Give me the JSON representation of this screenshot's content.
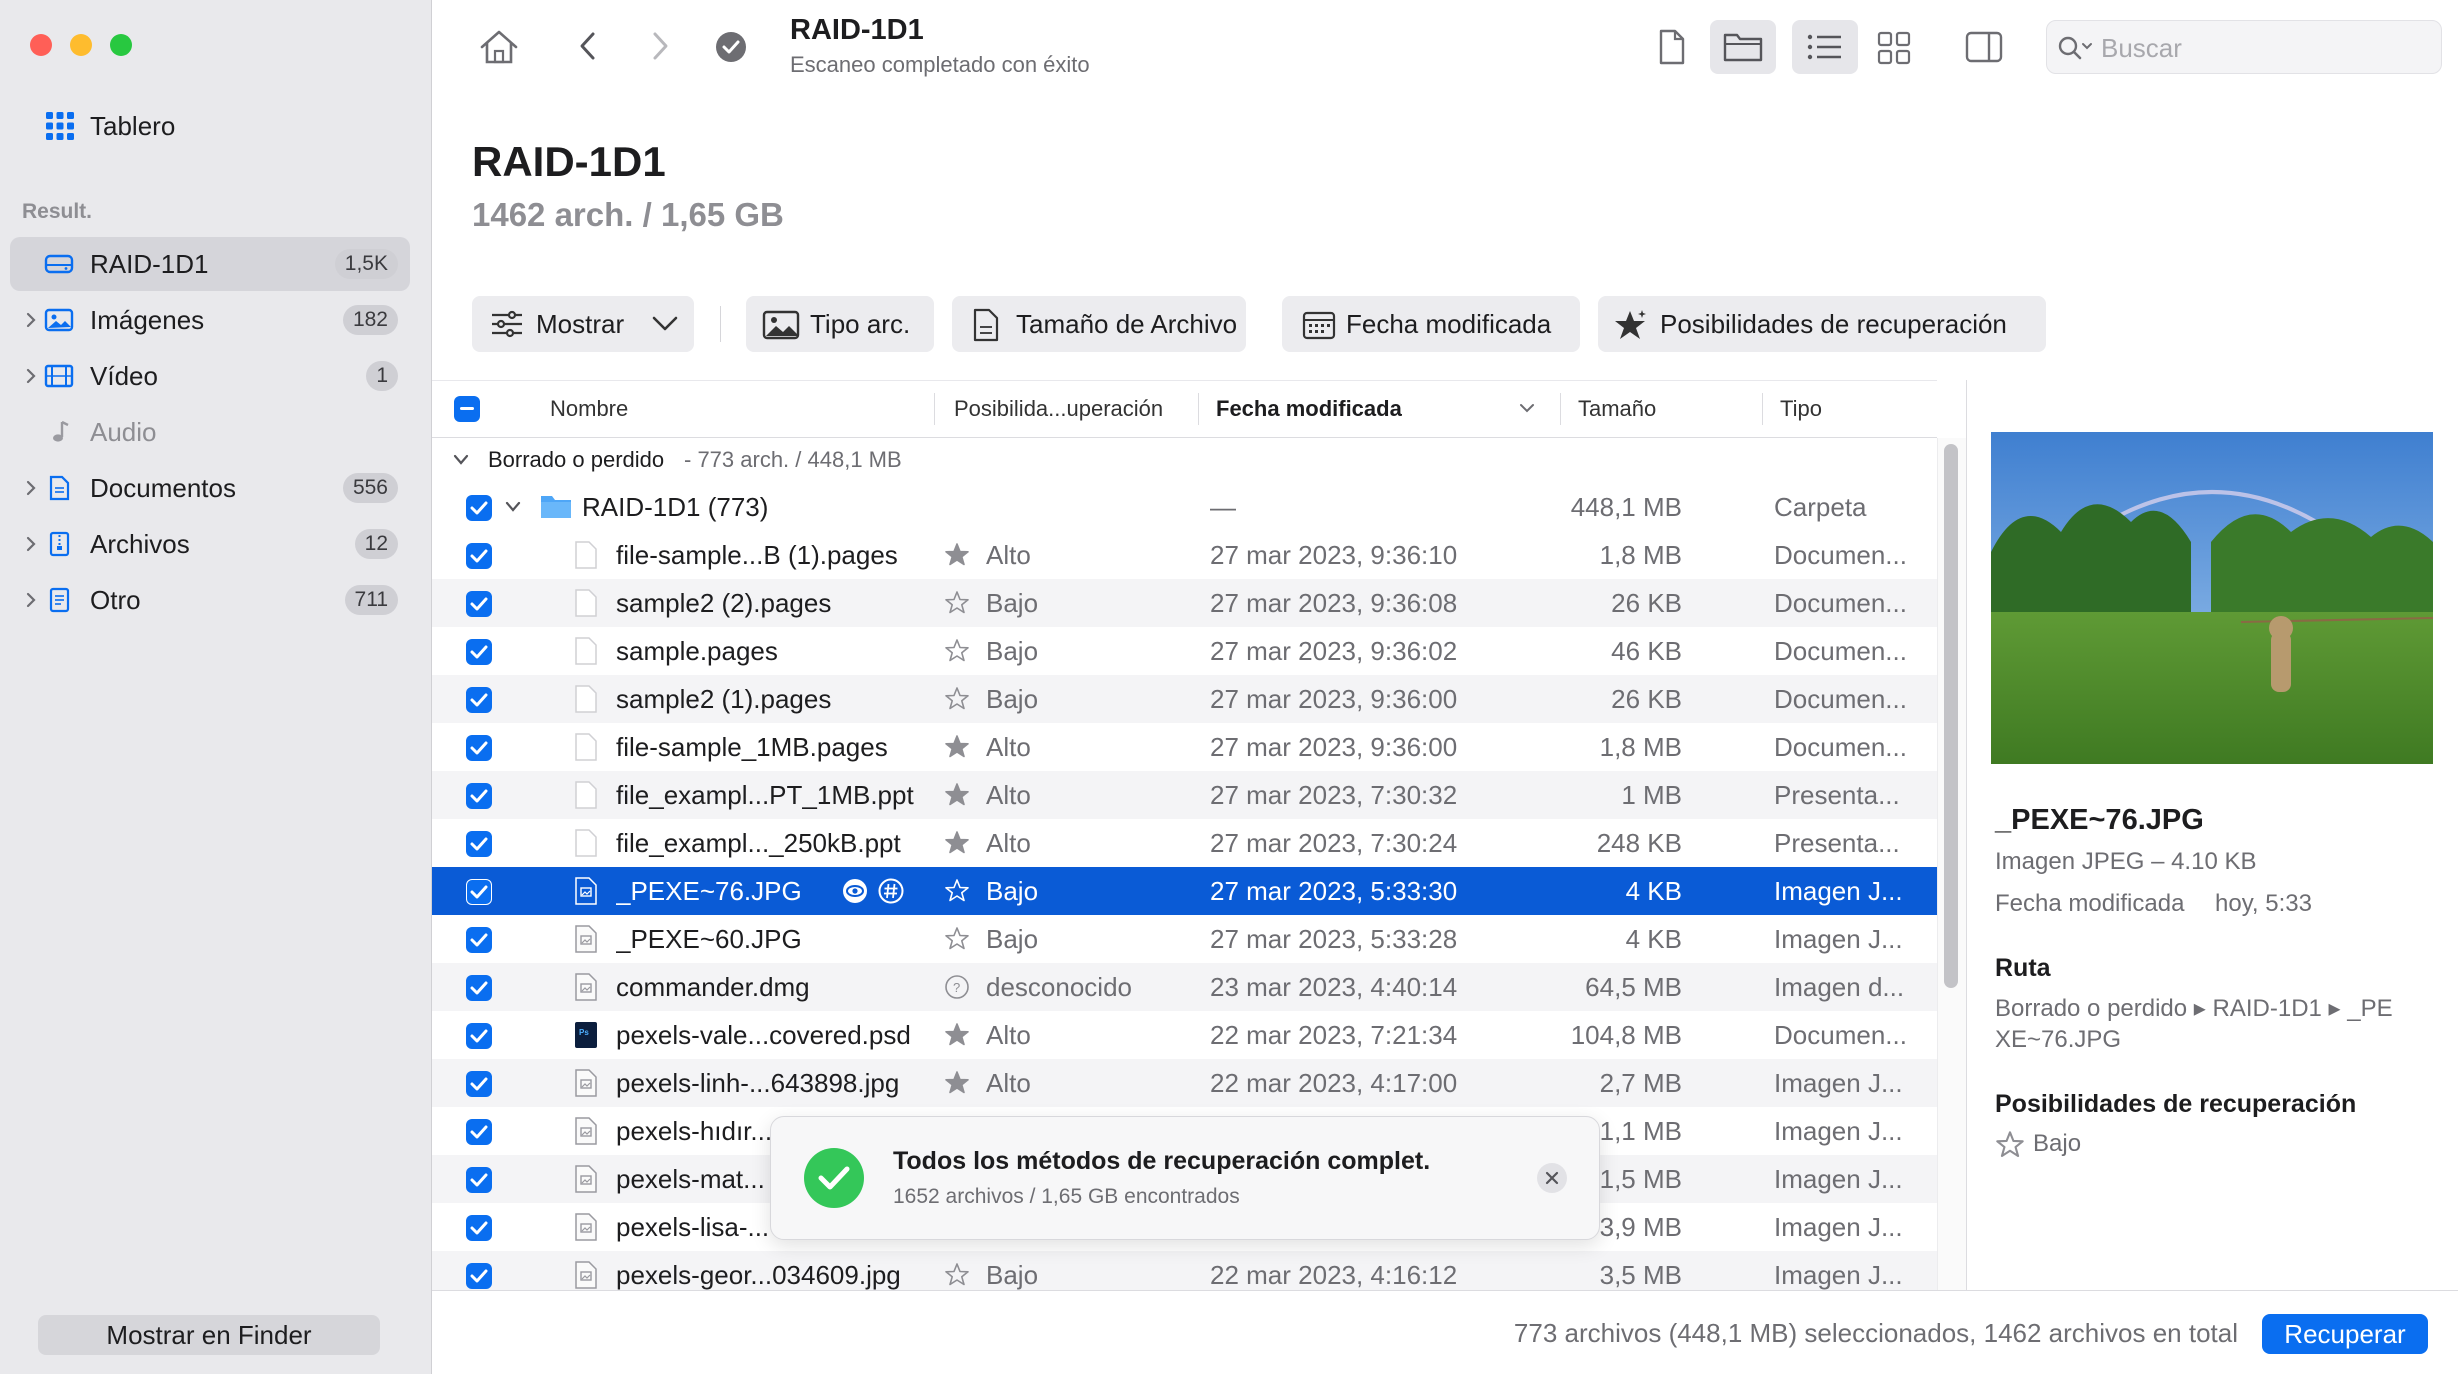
{
  "sidebar": {
    "dashboard_label": "Tablero",
    "results_header": "Result.",
    "items": [
      {
        "label": "RAID-1D1",
        "count": "1,5K",
        "icon": "drive-icon"
      },
      {
        "label": "Imágenes",
        "count": "182",
        "icon": "image-icon"
      },
      {
        "label": "Vídeo",
        "count": "1",
        "icon": "film-icon"
      },
      {
        "label": "Audio",
        "count": "",
        "icon": "music-note-icon"
      },
      {
        "label": "Documentos",
        "count": "556",
        "icon": "document-icon"
      },
      {
        "label": "Archivos",
        "count": "12",
        "icon": "archive-icon"
      },
      {
        "label": "Otro",
        "count": "711",
        "icon": "other-file-icon"
      }
    ],
    "finder_button": "Mostrar en Finder"
  },
  "toolbar": {
    "title": "RAID-1D1",
    "subtitle": "Escaneo completado con éxito",
    "search_placeholder": "Buscar"
  },
  "header": {
    "title": "RAID-1D1",
    "summary": "1462 arch. / 1,65 GB"
  },
  "filters": {
    "show": "Mostrar",
    "file_type": "Tipo arc.",
    "file_size": "Tamaño de Archivo",
    "date_modified": "Fecha modificada",
    "recovery_chances": "Posibilidades de recuperación"
  },
  "table": {
    "columns": {
      "name": "Nombre",
      "chance": "Posibilida...uperación",
      "date": "Fecha modificada",
      "size": "Tamaño",
      "type": "Tipo"
    },
    "group": {
      "label": "Borrado o perdido",
      "summary": " - 773 arch. / 448,1 MB"
    },
    "folder": {
      "name": "RAID-1D1 (773)",
      "date": "—",
      "size": "448,1 MB",
      "type": "Carpeta"
    },
    "rows": [
      {
        "name": "file-sample...B (1).pages",
        "chance": "Alto",
        "date": "27 mar 2023, 9:36:10",
        "size": "1,8 MB",
        "type": "Documen..."
      },
      {
        "name": "sample2 (2).pages",
        "chance": "Bajo",
        "date": "27 mar 2023, 9:36:08",
        "size": "26 KB",
        "type": "Documen..."
      },
      {
        "name": "sample.pages",
        "chance": "Bajo",
        "date": "27 mar 2023, 9:36:02",
        "size": "46 KB",
        "type": "Documen..."
      },
      {
        "name": "sample2 (1).pages",
        "chance": "Bajo",
        "date": "27 mar 2023, 9:36:00",
        "size": "26 KB",
        "type": "Documen..."
      },
      {
        "name": "file-sample_1MB.pages",
        "chance": "Alto",
        "date": "27 mar 2023, 9:36:00",
        "size": "1,8 MB",
        "type": "Documen..."
      },
      {
        "name": "file_exampl...PT_1MB.ppt",
        "chance": "Alto",
        "date": "27 mar 2023, 7:30:32",
        "size": "1 MB",
        "type": "Presenta..."
      },
      {
        "name": "file_exampl..._250kB.ppt",
        "chance": "Alto",
        "date": "27 mar 2023, 7:30:24",
        "size": "248 KB",
        "type": "Presenta..."
      },
      {
        "name": "_PEXE~76.JPG",
        "chance": "Bajo",
        "date": "27 mar 2023, 5:33:30",
        "size": "4 KB",
        "type": "Imagen J..."
      },
      {
        "name": "_PEXE~60.JPG",
        "chance": "Bajo",
        "date": "27 mar 2023, 5:33:28",
        "size": "4 KB",
        "type": "Imagen J..."
      },
      {
        "name": "commander.dmg",
        "chance": "desconocido",
        "date": "23 mar 2023, 4:40:14",
        "size": "64,5 MB",
        "type": "Imagen d..."
      },
      {
        "name": "pexels-vale...covered.psd",
        "chance": "Alto",
        "date": "22 mar 2023, 7:21:34",
        "size": "104,8 MB",
        "type": "Documen..."
      },
      {
        "name": "pexels-linh-...643898.jpg",
        "chance": "Alto",
        "date": "22 mar 2023, 4:17:00",
        "size": "2,7 MB",
        "type": "Imagen J..."
      },
      {
        "name": "pexels-hıdır...",
        "chance": "",
        "date": "",
        "size": "1,1 MB",
        "type": "Imagen J..."
      },
      {
        "name": "pexels-mat...",
        "chance": "",
        "date": "",
        "size": "1,5 MB",
        "type": "Imagen J..."
      },
      {
        "name": "pexels-lisa-...",
        "chance": "",
        "date": "",
        "size": "3,9 MB",
        "type": "Imagen J..."
      },
      {
        "name": "pexels-geor...034609.jpg",
        "chance": "Bajo",
        "date": "22 mar 2023, 4:16:12",
        "size": "3,5 MB",
        "type": "Imagen J..."
      }
    ]
  },
  "preview": {
    "filename": "_PEXE~76.JPG",
    "kind": "Imagen JPEG – 4.10 KB",
    "modified_label": "Fecha modificada",
    "modified_value": "hoy, 5:33",
    "path_label": "Ruta",
    "path_line1": "Borrado o perdido ▸ RAID-1D1 ▸ _PE",
    "path_line2": "XE~76.JPG",
    "chances_label": "Posibilidades de recuperación",
    "chances_value": "Bajo"
  },
  "toast": {
    "title": "Todos los métodos de recuperación complet.",
    "subtitle": "1652 archivos / 1,65 GB encontrados"
  },
  "footer": {
    "status": "773 archivos (448,1 MB) seleccionados, 1462 archivos en total",
    "recover_button": "Recuperar"
  },
  "colors": {
    "accent": "#0a6ef0",
    "selection": "#0a5bd6",
    "success": "#34c759",
    "sidebar_bg": "#e9e9ec"
  }
}
